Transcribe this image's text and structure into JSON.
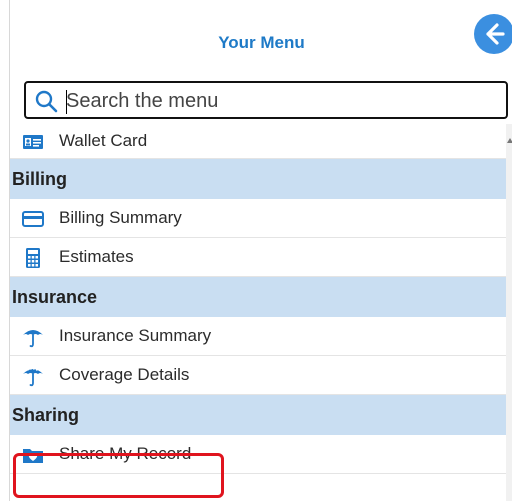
{
  "header": {
    "title": "Your Menu",
    "back_icon": "arrow-left-icon",
    "accent": "#1e7ac7"
  },
  "search": {
    "placeholder": "Search the menu",
    "value": "",
    "icon": "search-icon"
  },
  "menu": {
    "wallet_card": {
      "label": "Wallet Card",
      "icon": "id-card-icon"
    },
    "billing_section": "Billing",
    "billing_summary": {
      "label": "Billing Summary",
      "icon": "credit-card-icon"
    },
    "estimates": {
      "label": "Estimates",
      "icon": "calculator-icon"
    },
    "insurance_section": "Insurance",
    "insurance_summary": {
      "label": "Insurance Summary",
      "icon": "umbrella-icon"
    },
    "coverage_details": {
      "label": "Coverage Details",
      "icon": "umbrella-details-icon"
    },
    "sharing_section": "Sharing",
    "share_my_record": {
      "label": "Share My Record",
      "icon": "folder-heart-icon"
    }
  },
  "colors": {
    "section_background": "#c9def2",
    "highlight_border": "#e0141e",
    "icon_blue": "#1f78c8"
  }
}
